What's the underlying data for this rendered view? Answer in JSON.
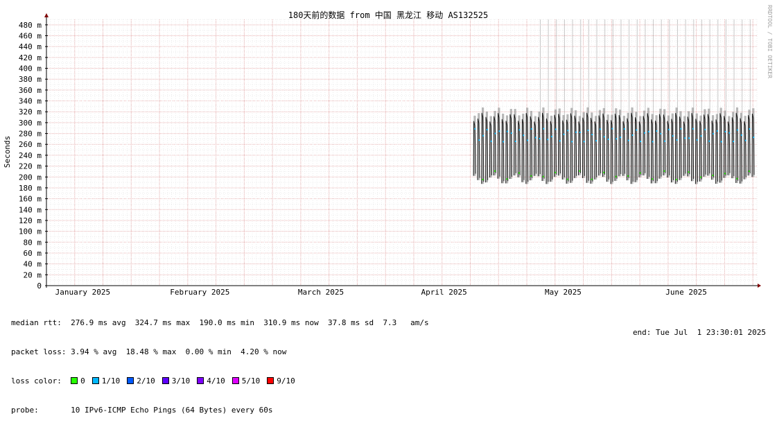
{
  "chart_data": {
    "type": "line",
    "title": "180天前的数据 from 中国 黑龙江 移动 AS132525",
    "ylabel": "Seconds",
    "ylim": [
      0,
      490
    ],
    "y_ticks": [
      {
        "v": 0,
        "label": "0"
      },
      {
        "v": 20,
        "label": "20 m"
      },
      {
        "v": 40,
        "label": "40 m"
      },
      {
        "v": 60,
        "label": "60 m"
      },
      {
        "v": 80,
        "label": "80 m"
      },
      {
        "v": 100,
        "label": "100 m"
      },
      {
        "v": 120,
        "label": "120 m"
      },
      {
        "v": 140,
        "label": "140 m"
      },
      {
        "v": 160,
        "label": "160 m"
      },
      {
        "v": 180,
        "label": "180 m"
      },
      {
        "v": 200,
        "label": "200 m"
      },
      {
        "v": 220,
        "label": "220 m"
      },
      {
        "v": 240,
        "label": "240 m"
      },
      {
        "v": 260,
        "label": "260 m"
      },
      {
        "v": 280,
        "label": "280 m"
      },
      {
        "v": 300,
        "label": "300 m"
      },
      {
        "v": 320,
        "label": "320 m"
      },
      {
        "v": 340,
        "label": "340 m"
      },
      {
        "v": 360,
        "label": "360 m"
      },
      {
        "v": 380,
        "label": "380 m"
      },
      {
        "v": 400,
        "label": "400 m"
      },
      {
        "v": 420,
        "label": "420 m"
      },
      {
        "v": 440,
        "label": "440 m"
      },
      {
        "v": 460,
        "label": "460 m"
      },
      {
        "v": 480,
        "label": "480 m"
      }
    ],
    "x_range_days": [
      0,
      176
    ],
    "x_ticks": [
      {
        "day": 9,
        "label": "January 2025"
      },
      {
        "day": 38,
        "label": "February 2025"
      },
      {
        "day": 68,
        "label": "March 2025"
      },
      {
        "day": 98.5,
        "label": "April 2025"
      },
      {
        "day": 128,
        "label": "May 2025"
      },
      {
        "day": 158.5,
        "label": "June 2025"
      }
    ],
    "series": [
      {
        "name": "median rtt",
        "data_start_day": 106,
        "data_end_day": 175.5,
        "daily_high_ms": 310,
        "daily_low_ms": 200,
        "median_ms": 276.9,
        "spike_ms": 490
      }
    ],
    "grid": true,
    "watermark": "RRDTOOL / TOBI OETIKER"
  },
  "stats": {
    "rtt_line": "median rtt:  276.9 ms avg  324.7 ms max  190.0 ms min  310.9 ms now  37.8 ms sd  7.3   am/s",
    "loss_line": "packet loss: 3.94 % avg  18.48 % max  0.00 % min  4.20 % now",
    "loss_color_label": "loss color:",
    "loss_colors": [
      {
        "label": "0",
        "color": "#26ff00"
      },
      {
        "label": "1/10",
        "color": "#00b8ff"
      },
      {
        "label": "2/10",
        "color": "#0059ff"
      },
      {
        "label": "3/10",
        "color": "#5e00ff"
      },
      {
        "label": "4/10",
        "color": "#7e00ff"
      },
      {
        "label": "5/10",
        "color": "#dd00ff"
      },
      {
        "label": "9/10",
        "color": "#ff0000"
      }
    ],
    "probe_line": "probe:       10 IPv6-ICMP Echo Pings (64 Bytes) every 60s",
    "end_line": "end: Tue Jul  1 23:30:01 2025"
  }
}
